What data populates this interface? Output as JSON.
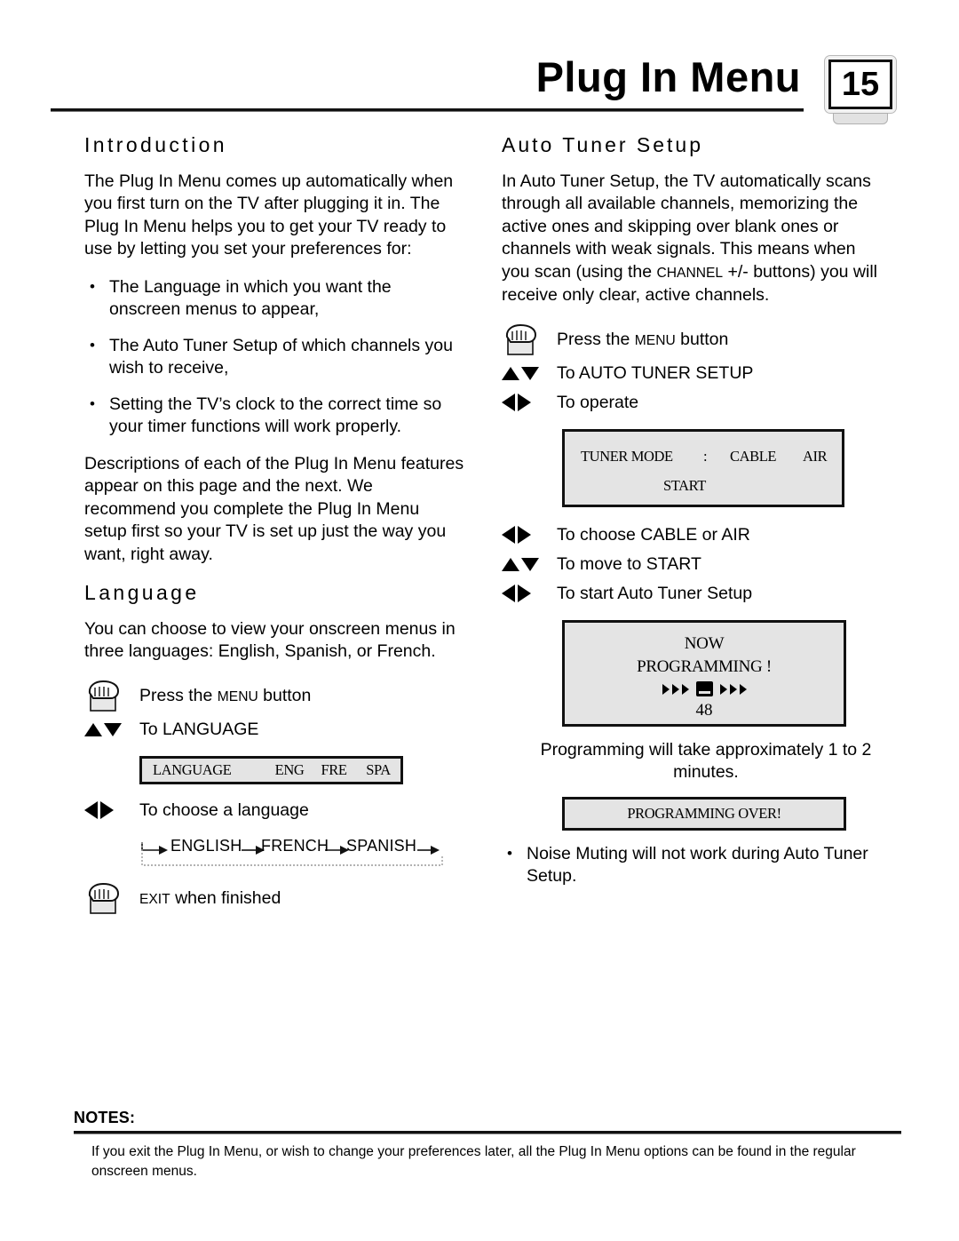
{
  "header": {
    "title": "Plug In Menu",
    "page_number": "15"
  },
  "left_column": {
    "intro": {
      "heading": "Introduction",
      "paragraph": "The Plug In Menu comes up automatically when you first turn on the TV after plugging it in. The Plug In Menu helps you to get your TV ready to use by letting you set your preferences for:",
      "bullets": [
        "The Language in which you want the onscreen menus to appear,",
        "The Auto Tuner Setup of which channels you wish to receive,",
        "Setting the TV’s clock to the correct time so your timer functions will work properly."
      ],
      "closing": "Descriptions of each of the Plug In Menu features appear on this page and the next. We recommend you complete the Plug In Menu setup first so your TV is set up just the way you want, right away."
    },
    "language": {
      "heading": "Language",
      "paragraph": "You can choose to view your onscreen menus in three languages: English, Spanish, or French.",
      "steps": [
        {
          "cue": "hand-button-icon",
          "text_lead": "Press the ",
          "text_caps": "Menu",
          "text_tail": " button"
        },
        {
          "cue": "up-down-arrows",
          "text": "To LANGUAGE"
        },
        {
          "cue": "left-right-arrows",
          "text": "To choose a language"
        },
        {
          "cue": "hand-button-icon",
          "text_caps": "Exit",
          "text_tail": " when finished"
        }
      ],
      "osd": {
        "label": "LANGUAGE",
        "options": [
          "ENG",
          "FRE",
          "SPA"
        ]
      },
      "cycle": [
        "ENGLISH",
        "FRENCH",
        "SPANISH"
      ]
    }
  },
  "right_column": {
    "auto_tuner": {
      "heading": "Auto Tuner Setup",
      "paragraph_part1": "In Auto Tuner Setup, the TV automatically scans through all available channels, memorizing the active ones and skipping over blank ones or channels with weak signals. This means when you scan (using the ",
      "paragraph_caps": "Channel",
      "paragraph_part2": " +/- buttons) you will receive only clear, active channels.",
      "steps_top": [
        {
          "cue": "hand-button-icon",
          "text_lead": "Press the ",
          "text_caps": "Menu",
          "text_tail": " button"
        },
        {
          "cue": "up-down-arrows",
          "text": "To AUTO TUNER SETUP"
        },
        {
          "cue": "left-right-arrows",
          "text": "To operate"
        }
      ],
      "osd_tuner": {
        "label": "TUNER MODE",
        "colon": ":",
        "option_cable": "CABLE",
        "option_air": "AIR",
        "start": "START"
      },
      "steps_mid": [
        {
          "cue": "left-right-arrows",
          "text": "To choose CABLE or AIR"
        },
        {
          "cue": "up-down-arrows",
          "text": "To move to START"
        },
        {
          "cue": "left-right-arrows",
          "text": "To start Auto Tuner Setup"
        }
      ],
      "osd_now": {
        "line1": "NOW",
        "line2": "PROGRAMMING !",
        "channel": "48"
      },
      "caption": "Programming will take approximately 1 to 2 minutes.",
      "osd_over": "PROGRAMMING OVER!",
      "note_bullet": "Noise Muting will not work during Auto Tuner Setup."
    }
  },
  "notes": {
    "title": "NOTES:",
    "body": "If you exit the Plug In Menu, or wish to change your preferences later, all the Plug In Menu options can be found in the regular onscreen menus."
  },
  "colors": {
    "osd_background": "#e4e4e4",
    "ink": "#000000",
    "page_background": "#ffffff"
  }
}
